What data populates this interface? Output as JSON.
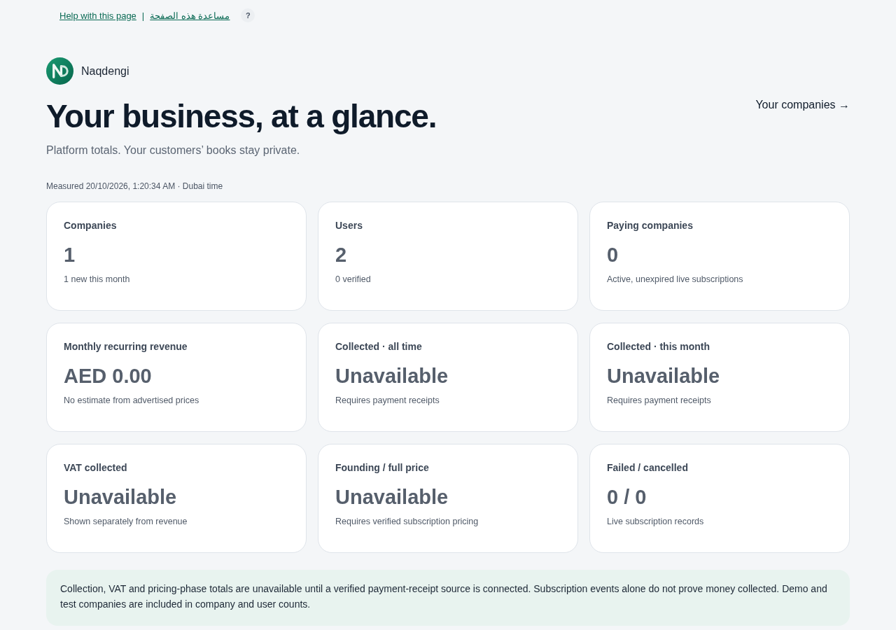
{
  "help_bar": {
    "links": [
      "Help with this page",
      "مساعدة هذه الصفحة"
    ],
    "separator": "|",
    "help_badge": "?"
  },
  "brand": {
    "name": "Naqdengi"
  },
  "header": {
    "title": "Your business, at a glance.",
    "subtitle": "Platform totals. Your customers’ books stay private.",
    "nav_link": "Your companies →"
  },
  "measured": "Measured 20/10/2026, 1:20:34 AM · Dubai time",
  "metrics": [
    {
      "label": "Companies",
      "value": "1",
      "note": "1 new this month"
    },
    {
      "label": "Users",
      "value": "2",
      "note": "0 verified"
    },
    {
      "label": "Paying companies",
      "value": "0",
      "note": "Active, unexpired live subscriptions"
    },
    {
      "label": "Monthly recurring revenue",
      "value": "AED 0.00",
      "note": "No estimate from advertised prices"
    },
    {
      "label": "Collected · all time",
      "value": "Unavailable",
      "note": "Requires payment receipts"
    },
    {
      "label": "Collected · this month",
      "value": "Unavailable",
      "note": "Requires payment receipts"
    },
    {
      "label": "VAT collected",
      "value": "Unavailable",
      "note": "Shown separately from revenue"
    },
    {
      "label": "Founding / full price",
      "value": "Unavailable",
      "note": "Requires verified subscription pricing"
    },
    {
      "label": "Failed / cancelled",
      "value": "0 / 0",
      "note": "Live subscription records"
    }
  ],
  "notice": "Collection, VAT and pricing-phase totals are unavailable until a verified payment-receipt source is connected. Subscription events alone do not prove money collected. Demo and test companies are included in company and user counts."
}
